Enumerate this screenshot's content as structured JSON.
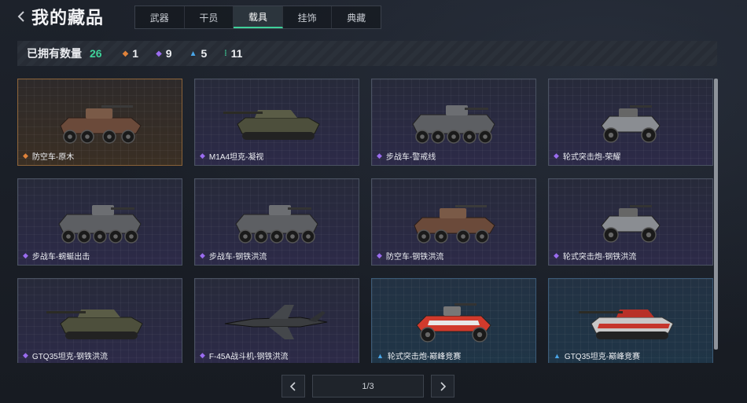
{
  "header": {
    "title": "我的藏品"
  },
  "tabs": [
    {
      "label": "武器",
      "active": false
    },
    {
      "label": "干员",
      "active": false
    },
    {
      "label": "载具",
      "active": true
    },
    {
      "label": "挂饰",
      "active": false
    },
    {
      "label": "典藏",
      "active": false
    }
  ],
  "stats": {
    "label": "已拥有数量",
    "total": "26",
    "items": [
      {
        "icon": "orange-diamond-icon",
        "color": "#e0823a",
        "value": "1"
      },
      {
        "icon": "purple-diamond-icon",
        "color": "#9b6cf0",
        "value": "9"
      },
      {
        "icon": "blue-triangle-icon",
        "color": "#4aa6e8",
        "value": "5"
      },
      {
        "icon": "green-dots-icon",
        "color": "#3fd19a",
        "value": "11"
      }
    ]
  },
  "colors": {
    "accent": "#3fd19a",
    "orange": "#e0823a",
    "purple": "#9b6cf0",
    "blue": "#4aa6e8"
  },
  "items": [
    {
      "name": "防空车-原木",
      "rarity": "orange",
      "vehicle": "wheeled-aa"
    },
    {
      "name": "M1A4坦克-凝视",
      "rarity": "purple",
      "vehicle": "tank"
    },
    {
      "name": "步战车-警戒线",
      "rarity": "purple",
      "vehicle": "ifv"
    },
    {
      "name": "轮式突击炮-荣耀",
      "rarity": "purple",
      "vehicle": "buggy"
    },
    {
      "name": "步战车-蜿蜒出击",
      "rarity": "purple",
      "vehicle": "ifv"
    },
    {
      "name": "步战车-钢铁洪流",
      "rarity": "purple",
      "vehicle": "ifv"
    },
    {
      "name": "防空车-钢铁洪流",
      "rarity": "purple",
      "vehicle": "wheeled-aa"
    },
    {
      "name": "轮式突击炮-钢铁洪流",
      "rarity": "purple",
      "vehicle": "buggy"
    },
    {
      "name": "GTQ35坦克-钢铁洪流",
      "rarity": "purple",
      "vehicle": "tank"
    },
    {
      "name": "F-45A战斗机-钢铁洪流",
      "rarity": "purple",
      "vehicle": "jet"
    },
    {
      "name": "轮式突击炮-巅峰竞赛",
      "rarity": "blue",
      "vehicle": "buggy-red"
    },
    {
      "name": "GTQ35坦克-巅峰竞赛",
      "rarity": "blue",
      "vehicle": "tank-red"
    }
  ],
  "pagination": {
    "label": "1/3"
  }
}
